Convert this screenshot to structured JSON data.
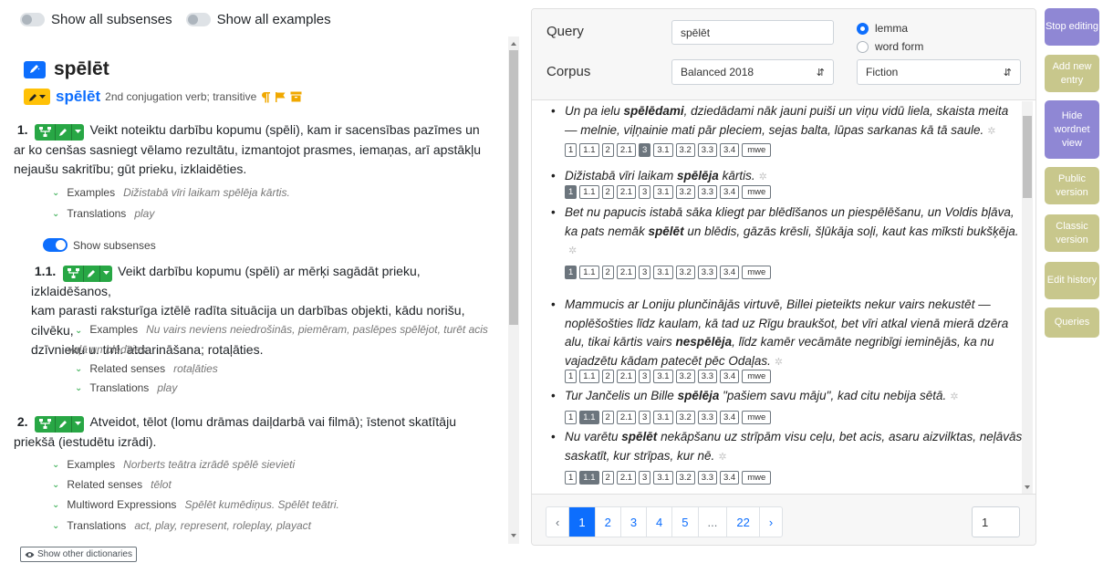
{
  "toggles": {
    "subsenses": "Show all subsenses",
    "examples": "Show all examples"
  },
  "entry": {
    "headword": "spēlēt",
    "lemma": "spēlēt",
    "grammar": "2nd conjugation verb; transitive"
  },
  "senses": [
    {
      "num": "1.",
      "text": "Veikt noteiktu darbību kopumu (spēli), kam ir sacensības pazīmes un",
      "text2": "ar ko cenšas sasniegt vēlamo rezultātu, izmantojot prasmes, iemaņas, arī apstākļu",
      "text3": "nejaušu sakritību; gūt prieku, izklaidēties.",
      "examples_label": "Examples",
      "examples": "Dižistabā vīri laikam spēlēja kārtis.",
      "translations_label": "Translations",
      "translations": "play",
      "show_subsenses": "Show subsenses"
    },
    {
      "num": "1.1.",
      "text": "Veikt darbību kopumu (spēli) ar mērķi sagādāt prieku, izklaidēšanos,",
      "text2": "kam parasti raksturīga iztēlē radīta situācija un darbības objekti, kādu norišu, cilvēku,",
      "text3": "dzīvnieku u. tml. atdarināšana; rotaļāties.",
      "examples_label": "Examples",
      "examples": "Nu vairs neviens neiedrošinās, piemēram, paslēpes spēlējot, turēt acis",
      "examples2": "vaļā un blēdīties.",
      "related_label": "Related senses",
      "related": "rotaļāties",
      "translations_label": "Translations",
      "translations": "play"
    },
    {
      "num": "2.",
      "text": "Atveidot, tēlot (lomu drāmas daiļdarbā vai filmā); īstenot skatītāju",
      "text2": "priekšā (iestudētu izrādi).",
      "examples_label": "Examples",
      "examples": "Norberts teātra izrādē spēlē sievieti",
      "related_label": "Related senses",
      "related": "tēlot",
      "mwe_label": "Multiword Expressions",
      "mwe": "Spēlēt kumēdiņus. Spēlēt teātri.",
      "translations_label": "Translations",
      "translations": "act, play, represent, roleplay, playact"
    }
  ],
  "other_dicts": "Show other dictionaries",
  "query": {
    "query_label": "Query",
    "query_value": "spēlēt",
    "radio_lemma": "lemma",
    "radio_wordform": "word form",
    "corpus_label": "Corpus",
    "corpus_value": "Balanced 2018",
    "genre_value": "Fiction"
  },
  "examples": [
    {
      "pre": "Un pa ielu ",
      "kw": "spēlēdami",
      "post": ", dziedādami nāk jauni puiši un viņu vidū liela, skaista meita — melnie, viļņainie mati pār pleciem, sejas balta, lūpas sarkanas kā tā saule.",
      "active": "3"
    },
    {
      "pre": "Dižistabā vīri laikam ",
      "kw": "spēlēja",
      "post": " kārtis.",
      "active": "1"
    },
    {
      "pre": "Bet nu papucis istabā sāka kliegt par blēdīšanos un piespēlēšanu, un Voldis bļāva, ka pats nemāk ",
      "kw": "spēlēt",
      "post": " un blēdis, gāzās krēsli, šļūkāja soļi, kaut kas mīksti bukšķēja.",
      "active": "1"
    },
    {
      "pre": "Mammucis ar Loniju plunčinājās virtuvē, Billei pieteikts nekur vairs nekustēt — noplēšošties līdz kaulam, kā tad uz Rīgu braukšot, bet vīri atkal vienā mierā dzēra alu, tikai kārtis vairs ",
      "kw": "nespēlēja",
      "post": ", līdz kamēr vecāmāte negribīgi ieminējās, ka nu vajadzētu kādam patecēt pēc Odaļas.",
      "active": ""
    },
    {
      "pre": "Tur Jančelis un Bille ",
      "kw": "spēlēja",
      "post": " \"pašiem savu māju\", kad citu nebija sētā.",
      "active": "1.1"
    },
    {
      "pre": "Nu varētu ",
      "kw": "spēlēt",
      "post": " nekāpšanu uz strīpām visu ceļu, bet acis, asaru aizvilktas, neļāvās saskatīt, kur strīpas, kur nē.",
      "active": "1.1"
    }
  ],
  "sense_tags": [
    "1",
    "1.1",
    "2",
    "2.1",
    "3",
    "3.1",
    "3.2",
    "3.3",
    "3.4",
    "mwe"
  ],
  "pagination": {
    "prev": "‹",
    "pages": [
      "1",
      "2",
      "3",
      "4",
      "5",
      "...",
      "22"
    ],
    "next": "›",
    "current": "1",
    "goto": "1"
  },
  "side_buttons": [
    {
      "label": "Stop editing",
      "color": "#8f87d4"
    },
    {
      "label": "Add new entry",
      "color": "#c8c78c"
    },
    {
      "label": "Hide wordnet view",
      "color": "#8f87d4"
    },
    {
      "label": "Public version",
      "color": "#c8c78c"
    },
    {
      "label": "Classic version",
      "color": "#c8c78c"
    },
    {
      "label": "Edit history",
      "color": "#c8c78c"
    },
    {
      "label": "Queries",
      "color": "#c8c78c"
    }
  ]
}
